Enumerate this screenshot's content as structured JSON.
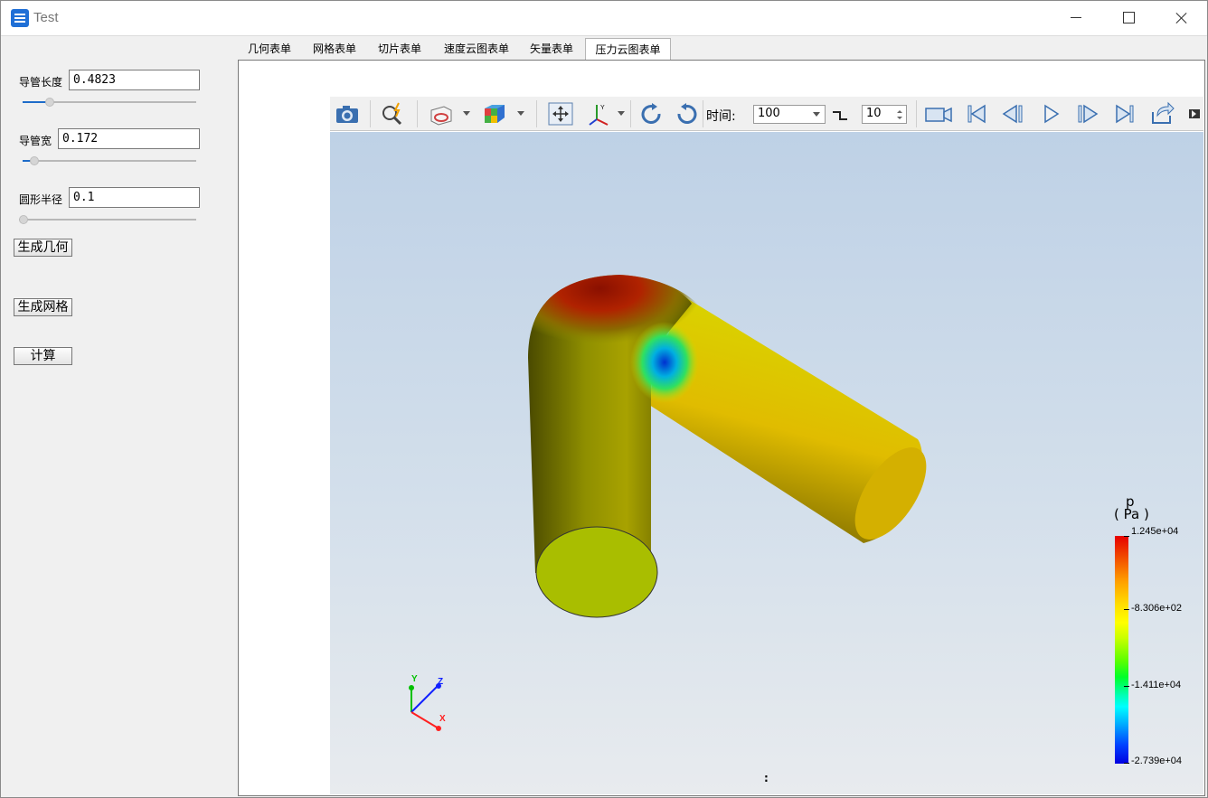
{
  "window": {
    "title": "Test"
  },
  "left_panel": {
    "params": [
      {
        "label": "导管长度",
        "value": "0.4823",
        "slider_fraction": 0.15
      },
      {
        "label": "导管宽",
        "value": "0.172",
        "slider_fraction": 0.07
      },
      {
        "label": "圆形半径",
        "value": "0.1",
        "slider_fraction": 0.0
      }
    ],
    "buttons": {
      "geometry": "生成几何",
      "mesh": "生成网格",
      "compute": "计算"
    }
  },
  "tabs": [
    {
      "label": "几何表单",
      "active": false
    },
    {
      "label": "网格表单",
      "active": false
    },
    {
      "label": "切片表单",
      "active": false
    },
    {
      "label": "速度云图表单",
      "active": false
    },
    {
      "label": "矢量表单",
      "active": false
    },
    {
      "label": "压力云图表单",
      "active": true
    }
  ],
  "toolbar": {
    "icons": [
      "camera-icon",
      "zoom-icon",
      "slice-box-icon",
      "color-cube-icon",
      "reset-view-icon",
      "axes-icon",
      "rotate-cw-icon",
      "rotate-ccw-icon",
      "record-icon",
      "first-frame-icon",
      "prev-frame-icon",
      "play-icon",
      "next-frame-icon",
      "last-frame-icon",
      "loop-icon"
    ],
    "time_label": "时间:",
    "time_value": "100",
    "step_value": "10"
  },
  "viewport": {
    "colorbar": {
      "title": "p",
      "unit": "( Pa )",
      "labels": [
        "1.245e+04",
        "-8.306e+02",
        "-1.411e+04",
        "-2.739e+04"
      ]
    },
    "axes": {
      "y": "Y",
      "z": "Z",
      "x": "X"
    },
    "status": ":"
  },
  "colors": {
    "accent": "#1e6cc9",
    "pipe": "#b7b800",
    "hot": "#cc1100"
  }
}
